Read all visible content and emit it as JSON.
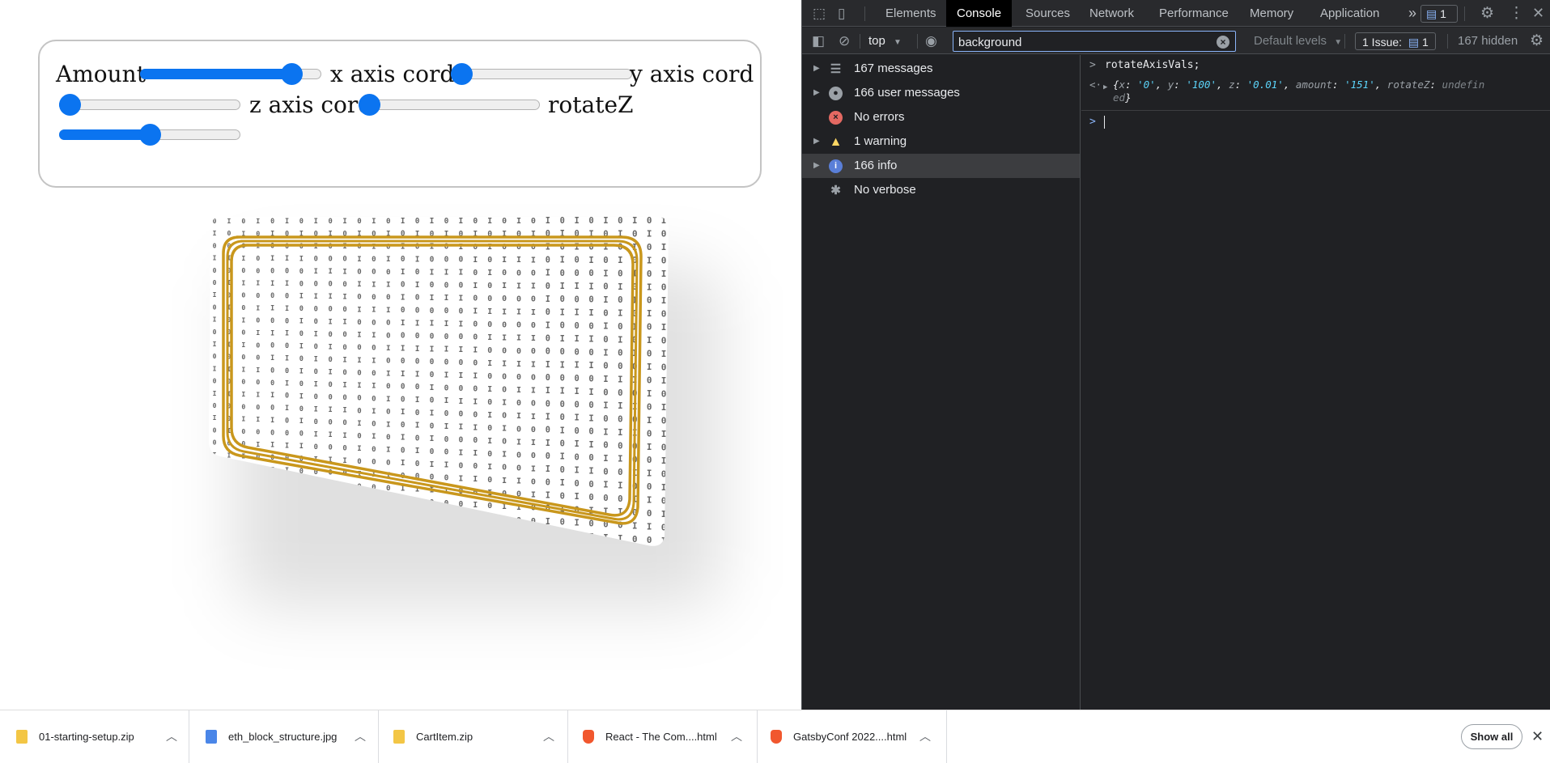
{
  "controls": {
    "amount": {
      "label": "Amount",
      "value": 0.88
    },
    "x_axis": {
      "label": "x axis cord",
      "value": 0.0
    },
    "y_axis": {
      "label": "y axis cord",
      "value": 0.0
    },
    "z_axis": {
      "label": "z axis cord",
      "value": 0.0
    },
    "rotate_z": {
      "label": "rotateZ",
      "value": 0.5
    }
  },
  "card": {
    "binary_columns": [
      "0I0I00I0I0I0I0I0I00I0I0I0I0",
      "I00I0I0I00I0I0I00I0I0I0I00I",
      "0I0I0I00I0I0I0I0I00I0I0I0I0",
      "I0I00I0I0I00I0I0I0I0I00I0I0",
      "0I0I0I0I0I0I00I0I0I0I0I00I0",
      "I00I0I0I0I0I0I0I00I0I0I0I0I",
      "0I0I00I0I0I0I0I0I0I00I0I0I0",
      "I0I0I0I00I0I0I0I0I0I0I00I0I",
      "0I00I0I0I0I0I00I0I0I0I0I0I0",
      "I0I0I0I0I00I0I0I0I0I0I0I00I",
      "0I0I0I0I0I0I0I00I0I0I0I0I0I",
      "I0I00I0I0I0I0I0I0I00I0I0I0I",
      "0I0I0I0I00I0I0I0I0I0I00I0I0",
      "I0I0I0I0I0I0I00I0I0I0I0I0I0",
      "0I0I0I00I0I0I0I0I0I00I0I0I0",
      "I0I0I0I0I0I00I0I0I0I0I0I00I",
      "0I00I0I0I0I0I0I0I00I0I0I0I0",
      "I0I0I0I0I0I0I0I0I0I0I00I0I0",
      "0I0I0I0I00I0I0I0I0I0I0I0I0I",
      "I0I0I00I0I0I0I0I0I0I0I0I0I0",
      "0I0I0I0I0I0I00I0I0I0I0I0I0I",
      "I00I0I0I0I0I0I0I0I00I0I0I0I",
      "0I0I0I0I0I0I0I0I0I0I0I00I0I",
      "I0I0I0I0I00I0I0I0I0I0I0I0I0",
      "0I0I0I0I0I0I0I00I0I0I0I0I0I",
      "I0I00I0I0I0I0I0I0I0I0I0I0I0",
      "0I0I0I0I0I0I0I0I0I0I00I0I0I",
      "I0I0I0I0I0I0I0I0I0I0I0I0I00",
      "0I0I0I0I0I00I0I0I0I0I0I0I0I",
      "I0I0I0I0I0I0I0I0I00I0I0I0I0",
      "0I0I0I0I0I0I0I0I0I0I0I0I0I0",
      "I0I0I0I0I0I0I0I0I0I0I0I0I0I"
    ],
    "border_color": "#c9971c"
  },
  "devtools": {
    "tabs": [
      "Elements",
      "Console",
      "Sources",
      "Network",
      "Performance",
      "Memory",
      "Application"
    ],
    "active_tab": "Console",
    "more_tabs": "»",
    "issues_badge": "1",
    "context": "top",
    "filter_value": "background",
    "levels": "Default levels",
    "issue_count": "1 Issue:",
    "issue_count_num": "1",
    "hidden": "167 hidden",
    "sidebar": [
      {
        "label": "167 messages",
        "icon": "list-icon",
        "expandable": true
      },
      {
        "label": "166 user messages",
        "icon": "user-icon",
        "expandable": true
      },
      {
        "label": "No errors",
        "icon": "error-icon",
        "expandable": false
      },
      {
        "label": "1 warning",
        "icon": "warning-icon",
        "expandable": true
      },
      {
        "label": "166 info",
        "icon": "info-icon",
        "expandable": true,
        "selected": true
      },
      {
        "label": "No verbose",
        "icon": "bug-icon",
        "expandable": false
      }
    ],
    "console": {
      "input_cmd": "rotateAxisVals;",
      "output": {
        "x_key": "x",
        "x_val": "'0'",
        "y_key": "y",
        "y_val": "'100'",
        "z_key": "z",
        "z_val": "'0.01'",
        "amount_key": "amount",
        "amount_val": "'151'",
        "rotate_key": "rotateZ",
        "rotate_val_1": "undefin",
        "rotate_val_2": "ed"
      }
    },
    "colors": {
      "bg": "#202124",
      "accent": "#8ab4f8",
      "string": "#5cd5fb",
      "key": "#9aa0a6"
    }
  },
  "downloads": {
    "items": [
      {
        "name": "01-starting-setup.zip",
        "icon": "zip-icon"
      },
      {
        "name": "eth_block_structure.jpg",
        "icon": "image-file-icon"
      },
      {
        "name": "CartItem.zip",
        "icon": "zip-icon"
      },
      {
        "name": "React - The Com....html",
        "icon": "brave-icon"
      },
      {
        "name": "GatsbyConf 2022....html",
        "icon": "brave-icon"
      }
    ],
    "show_all": "Show all"
  }
}
